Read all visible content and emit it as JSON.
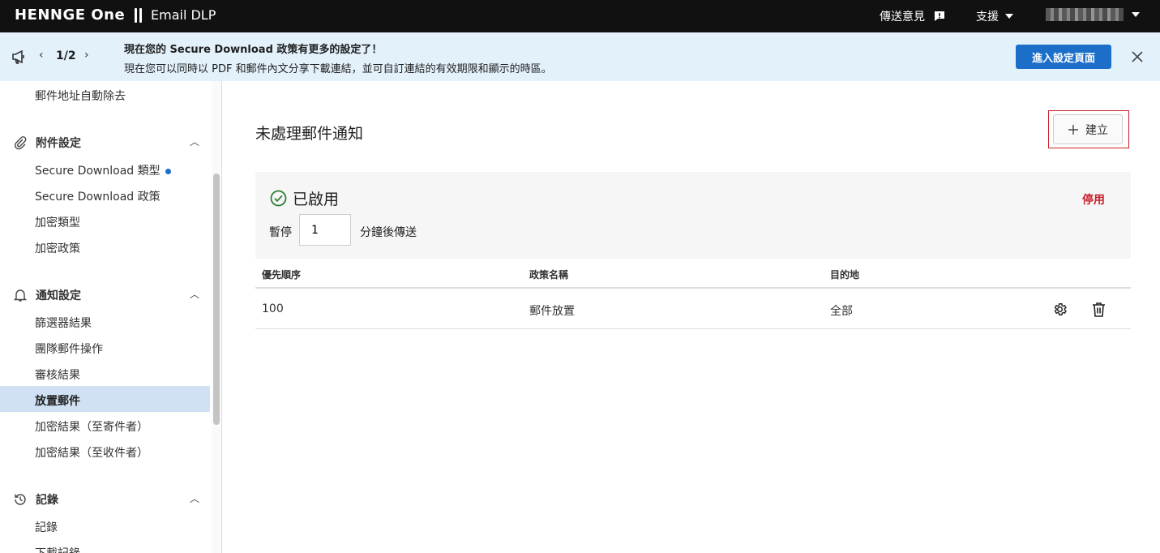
{
  "topbar": {
    "logo": "HENNGE One",
    "product": "Email DLP",
    "feedback": "傳送意見",
    "support": "支援"
  },
  "banner": {
    "page": "1/2",
    "title": "現在您的 Secure Download 政策有更多的設定了！",
    "desc": "現在您可以同時以 PDF 和郵件內文分享下載連結，並可自訂連結的有效期限和顯示的時區。",
    "button": "進入設定頁面"
  },
  "sidebar": {
    "top_item": "郵件地址自動除去",
    "attach_head": "附件設定",
    "attach_items": [
      "Secure Download 類型",
      "Secure Download 政策",
      "加密類型",
      "加密政策"
    ],
    "notify_head": "通知設定",
    "notify_items": [
      "篩選器結果",
      "團隊郵件操作",
      "審核結果",
      "放置郵件",
      "加密結果（至寄件者）",
      "加密結果（至收件者）"
    ],
    "log_head": "記錄",
    "log_items": [
      "記錄",
      "下載記錄"
    ]
  },
  "main": {
    "title": "未處理郵件通知",
    "create": "建立",
    "enabled": "已啟用",
    "disable": "停用",
    "pause_label": "暫停",
    "pause_value": "1",
    "pause_after": "分鐘後傳送",
    "columns": [
      "優先順序",
      "政策名稱",
      "目的地"
    ],
    "rows": [
      {
        "priority": "100",
        "name": "郵件放置",
        "destination": "全部"
      }
    ]
  },
  "colors": {
    "accent": "#1c6fc9",
    "danger": "#c8202a",
    "active_bg": "#cfe1f3",
    "banner_bg": "#e3f1fb"
  }
}
